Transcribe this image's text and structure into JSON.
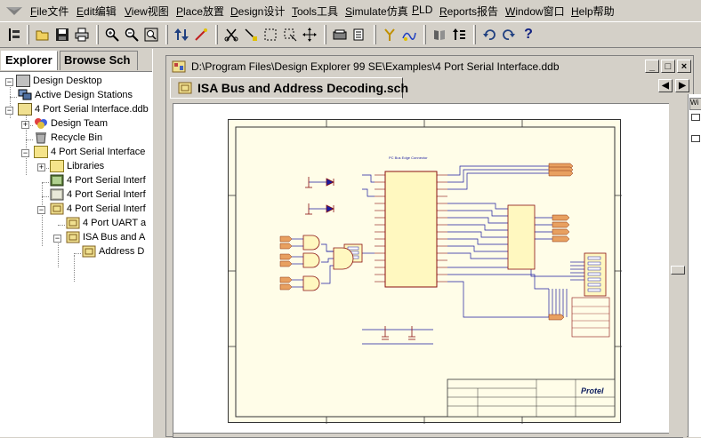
{
  "menu": [
    {
      "label": "File文件",
      "name": "menu-file"
    },
    {
      "label": "Edit编辑",
      "name": "menu-edit"
    },
    {
      "label": "View视图",
      "name": "menu-view"
    },
    {
      "label": "Place放置",
      "name": "menu-place"
    },
    {
      "label": "Design设计",
      "name": "menu-design"
    },
    {
      "label": "Tools工具",
      "name": "menu-tools"
    },
    {
      "label": "Simulate仿真",
      "name": "menu-simulate"
    },
    {
      "label": "PLD",
      "name": "menu-pld"
    },
    {
      "label": "Reports报告",
      "name": "menu-reports"
    },
    {
      "label": "Window窗口",
      "name": "menu-window"
    },
    {
      "label": "Help帮助",
      "name": "menu-help"
    }
  ],
  "panel": {
    "tabs": [
      "Explorer",
      "Browse Sch"
    ]
  },
  "tree": [
    {
      "label": "Design Desktop",
      "icon": "desktop-icon"
    },
    {
      "label": "Active Design Stations",
      "icon": "stations-icon"
    },
    {
      "label": "4 Port Serial Interface.ddb",
      "icon": "database-icon"
    },
    {
      "label": "Design Team",
      "icon": "team-icon"
    },
    {
      "label": "Recycle Bin",
      "icon": "recycle-bin-icon"
    },
    {
      "label": "4 Port Serial Interface",
      "icon": "folder-icon"
    },
    {
      "label": "Libraries",
      "icon": "folder-icon"
    },
    {
      "label": "4 Port Serial Interf",
      "icon": "document-icon"
    },
    {
      "label": "4 Port Serial Interf",
      "icon": "document-icon"
    },
    {
      "label": "4 Port Serial Interf",
      "icon": "schematic-icon"
    },
    {
      "label": "4 Port UART a",
      "icon": "schematic-icon"
    },
    {
      "label": "ISA Bus and A",
      "icon": "schematic-icon"
    },
    {
      "label": "Address D",
      "icon": "schematic-icon"
    }
  ],
  "document": {
    "window_title": "D:\\Program Files\\Design Explorer 99 SE\\Examples\\4 Port Serial Interface.ddb",
    "tab_label": "ISA Bus and Address Decoding.sch",
    "min_label": "_",
    "max_label": "□",
    "close_label": "×"
  },
  "sheet": {
    "connector_title": "PC Bus Edge Connector",
    "logo": "Protel"
  },
  "colors": {
    "chrome": "#d4d0c8",
    "sheet_bg": "#fffde8",
    "wire": "#1c1ca0",
    "component": "#8a1010",
    "port": "#e8a060"
  }
}
